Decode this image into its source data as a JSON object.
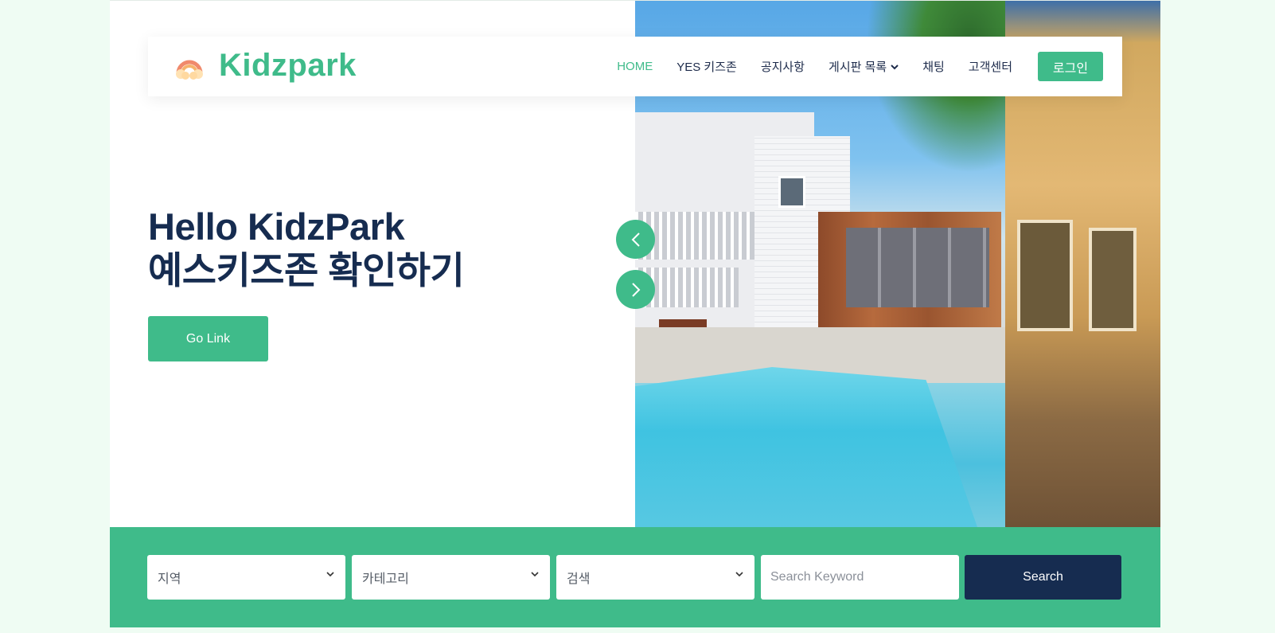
{
  "brand": {
    "name": "Kidzpark",
    "accent": "#3fbb8a",
    "navy": "#162c50",
    "logo_icon": "rainbow-cloud-icon"
  },
  "nav": {
    "items": [
      {
        "label": "HOME",
        "active": true
      },
      {
        "label": "YES 키즈존"
      },
      {
        "label": "공지사항"
      },
      {
        "label": "게시판 목록",
        "has_dropdown": true
      },
      {
        "label": "채팅"
      },
      {
        "label": "고객센터"
      }
    ],
    "login_label": "로그인"
  },
  "hero": {
    "title_line1": "Hello KidzPark",
    "title_line2": "예스키즈존 확인하기",
    "button_label": "Go Link",
    "prev_icon": "chevron-left-icon",
    "next_icon": "chevron-right-icon",
    "image": "house-with-pool-photo"
  },
  "search": {
    "region_placeholder": "지역",
    "category_placeholder": "카테고리",
    "search_type_placeholder": "검색",
    "keyword_placeholder": "Search Keyword",
    "button_label": "Search"
  }
}
